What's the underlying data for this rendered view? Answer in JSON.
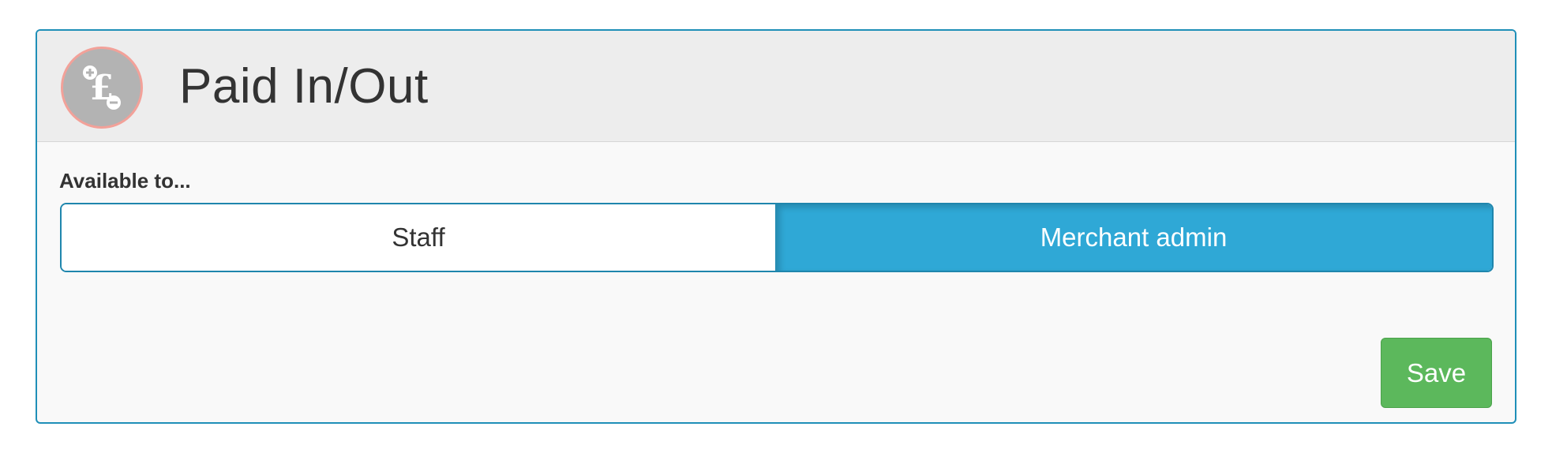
{
  "header": {
    "title": "Paid In/Out",
    "logo_icon": "pound-plus-minus-icon",
    "logo_glyph": "£"
  },
  "availability": {
    "label": "Available to...",
    "options": [
      {
        "label": "Staff",
        "selected": false
      },
      {
        "label": "Merchant admin",
        "selected": true
      }
    ]
  },
  "actions": {
    "save_label": "Save"
  },
  "colors": {
    "accent": "#2fa8d6",
    "border": "#1f8fb8",
    "save": "#5cb85c",
    "logo_bg": "#b3b3b3",
    "logo_ring": "#f2a199"
  }
}
